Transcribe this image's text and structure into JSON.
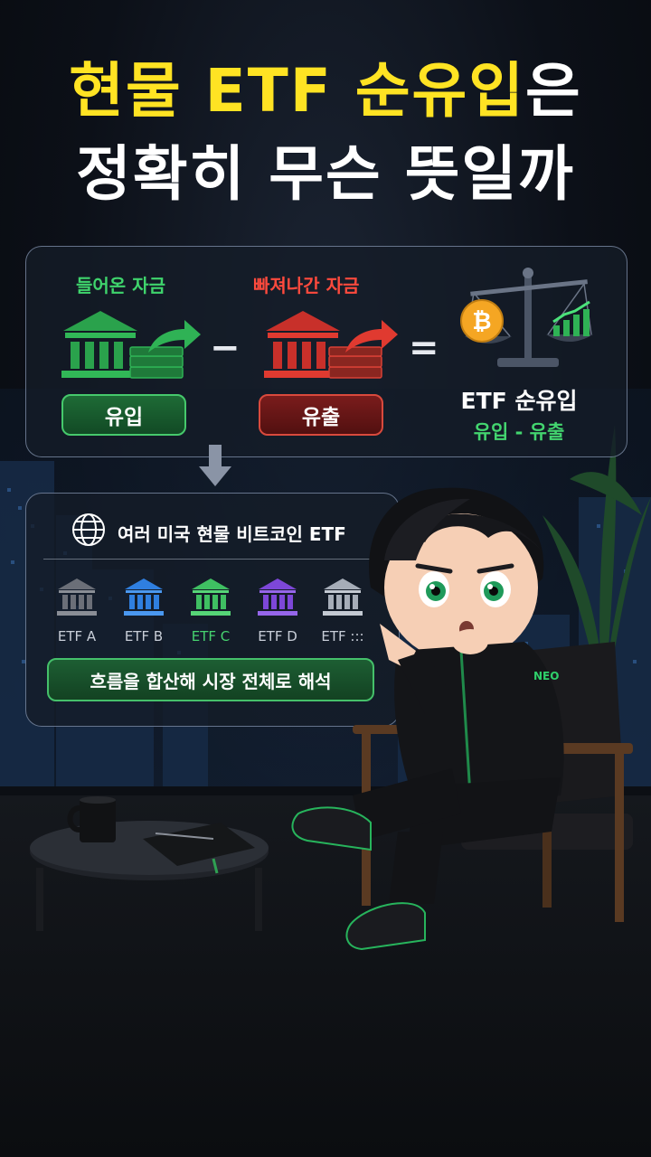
{
  "title": {
    "line1_highlight": "현물 ETF 순유입",
    "line1_tail": "은",
    "line2": "정확히 무슨 뜻일까"
  },
  "flow": {
    "inflow_caption": "들어온 자금",
    "outflow_caption": "빠져나간 자금",
    "inflow_label": "유입",
    "outflow_label": "유출",
    "minus": "−",
    "equals": "=",
    "net_title": "ETF 순유입",
    "net_formula": "유입 - 유출"
  },
  "etfs": {
    "heading": "여러 미국 현물 비트코인 ETF",
    "items": [
      {
        "label": "ETF A",
        "color": "#6b6f78"
      },
      {
        "label": "ETF B",
        "color": "#2f7fe0"
      },
      {
        "label": "ETF C",
        "color": "#3fbf62"
      },
      {
        "label": "ETF D",
        "color": "#7d47d8"
      },
      {
        "label": "ETF :::",
        "color": "#a6adb8"
      }
    ],
    "summary": "흐름을 합산해 시장 전체로 해석"
  },
  "character": {
    "jacket_text": "NEO"
  },
  "colors": {
    "title_yellow": "#ffe323",
    "inflow_green": "#3fd46c",
    "outflow_red": "#ff4a3d",
    "bitcoin": "#f5a623"
  },
  "icons": [
    "bank-icon",
    "cash-stack-icon",
    "arrow-icon",
    "scale-icon",
    "bitcoin-icon",
    "chart-up-icon",
    "globe-icon",
    "down-arrow-icon"
  ]
}
